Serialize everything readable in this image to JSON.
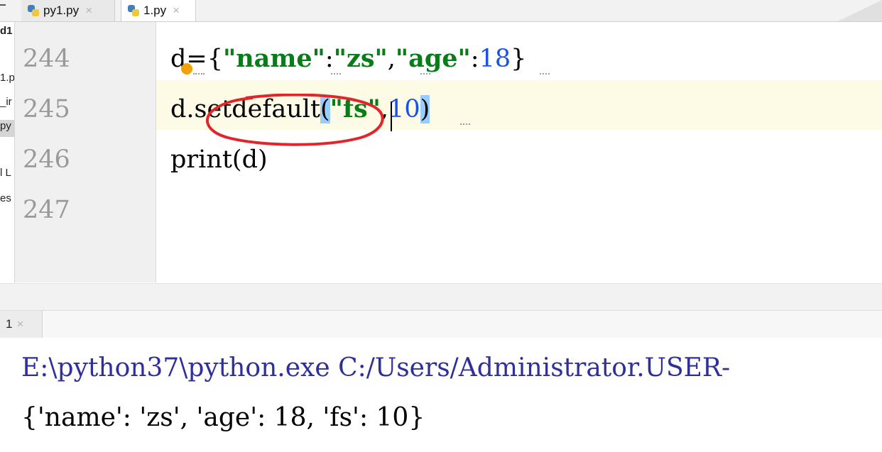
{
  "tabs": [
    {
      "label": "py1.py",
      "close": "×",
      "active": false
    },
    {
      "label": "1.py",
      "close": "×",
      "active": true
    }
  ],
  "project_panel": {
    "items": [
      "d1",
      "1.p",
      "_ir",
      "py",
      "l L",
      "es"
    ]
  },
  "editor": {
    "line_numbers": [
      "244",
      "245",
      "246",
      "247"
    ],
    "lines": {
      "l244": {
        "a": "d={",
        "b": "\"name\"",
        "c": ":",
        "d": "\"zs\"",
        "e": ",",
        "f": "\"age\"",
        "g": ":",
        "h": "18",
        "i": "}"
      },
      "l245": {
        "a": "d.",
        "b": "setdefault",
        "c": "(",
        "d": "\"fs\"",
        "e": ",",
        "f": "10",
        "g": ")"
      },
      "l246": {
        "a": "print(d)"
      }
    }
  },
  "run_panel": {
    "tab_label": "1",
    "tab_close": "×"
  },
  "console": {
    "command": "E:\\python37\\python.exe C:/Users/Administrator.USER-",
    "output": "{'name': 'zs', 'age': 18, 'fs': 10}"
  },
  "colors": {
    "string": "#067d17",
    "number": "#1750eb",
    "bracket_highlight": "#99ccff",
    "current_line": "#fdfbe6",
    "annotation_circle": "#e0262a",
    "console_command": "#2f2f9a"
  }
}
